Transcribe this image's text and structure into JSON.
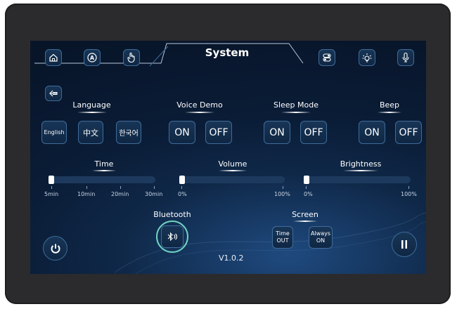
{
  "header": {
    "title": "System"
  },
  "nav_icons": [
    "home-icon",
    "autoplay-icon",
    "hand-icon",
    "toggle-switch-icon",
    "sun-icon",
    "microphone-icon"
  ],
  "language": {
    "label": "Language",
    "options": [
      "English",
      "中文",
      "한국어"
    ]
  },
  "voice_demo": {
    "label": "Voice Demo",
    "on": "ON",
    "off": "OFF"
  },
  "sleep_mode": {
    "label": "Sleep Mode",
    "on": "ON",
    "off": "OFF"
  },
  "beep": {
    "label": "Beep",
    "on": "ON",
    "off": "OFF"
  },
  "time": {
    "label": "Time",
    "ticks": [
      "5min",
      "10min",
      "20min",
      "30min"
    ],
    "value": "5min"
  },
  "volume": {
    "label": "Volume",
    "min_label": "0%",
    "max_label": "100%",
    "value_percent": 0
  },
  "brightness": {
    "label": "Brightness",
    "min_label": "0%",
    "max_label": "100%",
    "value_percent": 0
  },
  "bluetooth": {
    "label": "Bluetooth",
    "icon": "bluetooth-icon"
  },
  "screen": {
    "label": "Screen",
    "timeout_line1": "Time",
    "timeout_line2": "OUT",
    "always_line1": "Always",
    "always_line2": "ON"
  },
  "version": "V1.0.2",
  "colors": {
    "accent_border": "#3f6c9a",
    "bluetooth_ring": "#6fd3c1",
    "panel_bg": "#0a1c36"
  }
}
